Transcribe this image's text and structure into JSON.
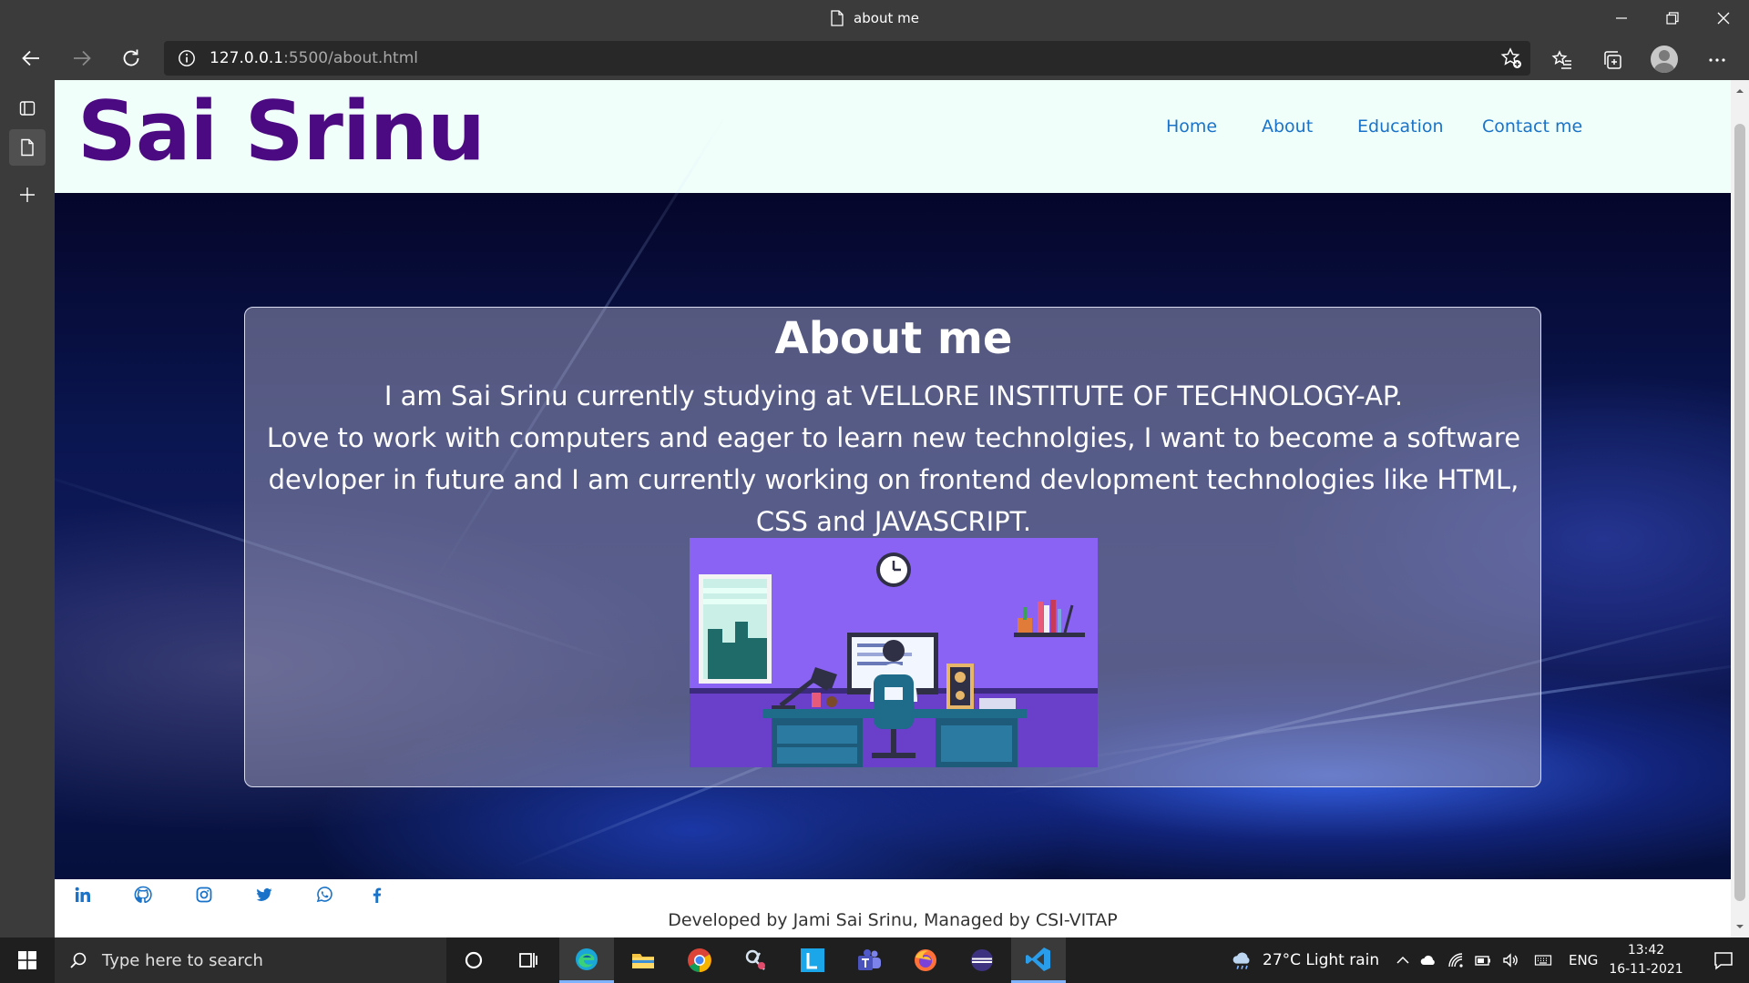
{
  "browser": {
    "tab_title": "about me",
    "url_host": "127.0.0.1",
    "url_path": ":5500/about.html"
  },
  "site": {
    "logo": "Sai Srinu",
    "nav": [
      {
        "label": "Home"
      },
      {
        "label": "About"
      },
      {
        "label": "Education"
      },
      {
        "label": "Contact me"
      }
    ],
    "about": {
      "title": "About me",
      "line1": "I am Sai Srinu currently studying at VELLORE INSTITUTE OF TECHNOLOGY-AP.",
      "line2": "Love to work with computers and eager to learn new technolgies, I want to become a software devloper in future and I am currently working on frontend devlopment technologies like HTML, CSS and JAVASCRIPT."
    },
    "footer": {
      "social_icons": [
        "linkedin-icon",
        "github-icon",
        "instagram-icon",
        "twitter-icon",
        "whatsapp-icon",
        "facebook-icon"
      ],
      "credits": "Developed by Jami Sai Srinu, Managed by CSI-VITAP"
    },
    "colors": {
      "logo": "#4b0a82",
      "nav_link": "#1a73c8",
      "header_bg": "#f1fffa",
      "social_icon": "#1a73c8"
    }
  },
  "taskbar": {
    "search_placeholder": "Type here to search",
    "weather": "27°C  Light rain",
    "language": "ENG",
    "time": "13:42",
    "date": "16-11-2021"
  }
}
